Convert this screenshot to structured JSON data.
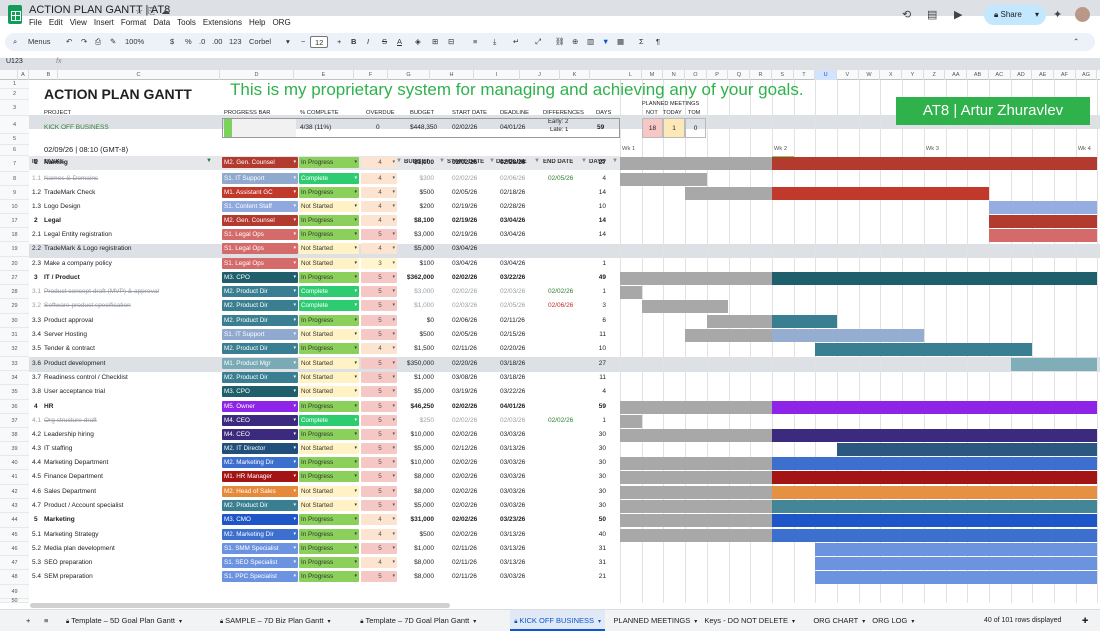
{
  "doc": {
    "title": "ACTION PLAN GANTT | AT8",
    "menus": [
      "File",
      "Edit",
      "View",
      "Insert",
      "Format",
      "Data",
      "Tools",
      "Extensions",
      "Help",
      "ORG"
    ],
    "share": "Share"
  },
  "toolbar": {
    "menus": "Menus",
    "zoom": "100%",
    "currency": "$",
    "percent": "%",
    "dec_less": ".0",
    "dec_more": ".00",
    "num_fmt": "123",
    "font": "Corbel",
    "font_size": "12",
    "bold": "B",
    "italic": "I",
    "strike": "S",
    "text_color": "A",
    "sigma": "Σ"
  },
  "formula": {
    "namebox": "U123",
    "fx": "fx"
  },
  "columns": [
    "A",
    "B",
    "C",
    "D",
    "E",
    "F",
    "G",
    "H",
    "I",
    "J",
    "K",
    "L",
    "M",
    "N",
    "O",
    "P",
    "Q",
    "R",
    "S",
    "T",
    "U",
    "V",
    "W",
    "X",
    "Y",
    "Z",
    "AA",
    "AB",
    "AC",
    "AD",
    "AE",
    "AF",
    "AG"
  ],
  "row_numbers": [
    "1",
    "2",
    "3",
    "4",
    "5",
    "6",
    "7",
    "8",
    "9",
    "10",
    "17",
    "18",
    "19",
    "20",
    "27",
    "28",
    "29",
    "30",
    "31",
    "32",
    "33",
    "34",
    "35",
    "36",
    "37",
    "38",
    "39",
    "40",
    "41",
    "42",
    "43",
    "44",
    "45",
    "46",
    "47",
    "48",
    "49",
    "50",
    "51",
    "52",
    "53"
  ],
  "sheet": {
    "big_title": "ACTION PLAN GANTT",
    "tagline": "This is my proprietary system for managing and achieving any of your goals.",
    "brand": "AT8 | Artur Zhuravlev",
    "summary_headers": {
      "project": "PROJECT",
      "progress": "PROGRESS BAR",
      "complete": "% COMPLETE",
      "overdue": "OVERDUE",
      "budget": "BUDGET",
      "start": "START DATE",
      "deadline": "DEADLINE",
      "diff": "DIFFERENCES",
      "days": "DAYS"
    },
    "summary_values": {
      "project": "KICK OFF BUSINESS",
      "complete": "4/38 (11%)",
      "overdue": "0",
      "budget": "$448,350",
      "start": "02/02/26",
      "deadline": "04/01/26",
      "diff_early": "Early: 2",
      "diff_late": "Late: 1",
      "days": "59"
    },
    "progress_fraction": 0.11,
    "meetings": {
      "title": "PLANNED MEETINGS",
      "not_label": "NOT",
      "today_label": "TODAY",
      "tom_label": "TOM",
      "not": "18",
      "today": "1",
      "tom": "0"
    },
    "timestamp": "02/09/26 | 08:10 (GMT-8)",
    "week_labels": [
      "Wk 1",
      "Wk 2",
      "Wk 3",
      "Wk 4"
    ],
    "dates": [
      "2/2",
      "2/3",
      "2/4",
      "2/5",
      "2/6",
      "2/7",
      "2/8",
      "2/9",
      "2/10",
      "2/11",
      "2/12",
      "2/13",
      "2/14",
      "2/15",
      "2/16",
      "2/17",
      "2/18",
      "2/19",
      "2/20",
      "2/21",
      "2/22",
      "2/23"
    ],
    "table_headers": {
      "id": "ID",
      "tasks": "TASKS",
      "owner": "TASK OWNER",
      "status": "STATUS",
      "priority": "PRIORITY",
      "budget": "BUDGET",
      "start": "START DATE",
      "deadline": "DEADLINE",
      "end": "END DATE",
      "days": "DAYS"
    }
  },
  "tasks": [
    {
      "id": "1",
      "name": "Naming",
      "owner": "M2. Gen. Counsel",
      "status": "In Progress",
      "priority": "4",
      "budget": "$1,000",
      "start": "02/02/26",
      "deadline": "02/28/26",
      "end": "",
      "days": "27",
      "group": true
    },
    {
      "id": "1.1",
      "name": "Names & Domains",
      "owner": "S1. IT Support",
      "status": "Complete",
      "priority": "4",
      "budget": "$300",
      "start": "02/02/26",
      "deadline": "02/06/26",
      "end": "02/05/26",
      "days": "4",
      "done": true
    },
    {
      "id": "1.2",
      "name": "TradeMark Check",
      "owner": "M1. Assistant GC",
      "status": "In Progress",
      "priority": "4",
      "budget": "$500",
      "start": "02/05/26",
      "deadline": "02/18/26",
      "end": "",
      "days": "14"
    },
    {
      "id": "1.3",
      "name": "Logo Design",
      "owner": "S1. Content Staff",
      "status": "Not Started",
      "priority": "4",
      "budget": "$200",
      "start": "02/19/26",
      "deadline": "02/28/26",
      "end": "",
      "days": "10"
    },
    {
      "id": "2",
      "name": "Legal",
      "owner": "M2. Gen. Counsel",
      "status": "In Progress",
      "priority": "4",
      "budget": "$8,100",
      "start": "02/19/26",
      "deadline": "03/04/26",
      "end": "",
      "days": "14",
      "group": true
    },
    {
      "id": "2.1",
      "name": "Legal Entity registration",
      "owner": "S1. Legal Ops",
      "status": "In Progress",
      "priority": "5",
      "budget": "$3,000",
      "start": "02/19/26",
      "deadline": "03/04/26",
      "end": "",
      "days": "14"
    },
    {
      "id": "2.2",
      "name": "TradeMark & Logo registration",
      "owner": "S1. Legal Ops",
      "status": "Not Started",
      "priority": "4",
      "budget": "$5,000",
      "start": "03/04/26",
      "deadline": "",
      "end": "",
      "days": ""
    },
    {
      "id": "2.3",
      "name": "Make a company policy",
      "owner": "S1. Legal Ops",
      "status": "Not Started",
      "priority": "3",
      "budget": "$100",
      "start": "03/04/26",
      "deadline": "03/04/26",
      "end": "",
      "days": "1"
    },
    {
      "id": "3",
      "name": "IT / Product",
      "owner": "M3. CPO",
      "status": "In Progress",
      "priority": "5",
      "budget": "$362,000",
      "start": "02/02/26",
      "deadline": "03/22/26",
      "end": "",
      "days": "49",
      "group": true
    },
    {
      "id": "3.1",
      "name": "Product concept draft (MVP) & approval",
      "owner": "M2. Product Dir",
      "status": "Complete",
      "priority": "5",
      "budget": "$3,000",
      "start": "02/02/26",
      "deadline": "02/03/26",
      "end": "02/02/26",
      "days": "1",
      "done": true
    },
    {
      "id": "3.2",
      "name": "Software product specification",
      "owner": "M2. Product Dir",
      "status": "Complete",
      "priority": "5",
      "budget": "$1,000",
      "start": "02/03/26",
      "deadline": "02/05/26",
      "end": "02/06/26",
      "days": "3",
      "done": true,
      "late": true
    },
    {
      "id": "3.3",
      "name": "Product approval",
      "owner": "M2. Product Dir",
      "status": "In Progress",
      "priority": "5",
      "budget": "$0",
      "start": "02/06/26",
      "deadline": "02/11/26",
      "end": "",
      "days": "6"
    },
    {
      "id": "3.4",
      "name": "Server Hosting",
      "owner": "S1. IT Support",
      "status": "Not Started",
      "priority": "5",
      "budget": "$500",
      "start": "02/05/26",
      "deadline": "02/15/26",
      "end": "",
      "days": "11"
    },
    {
      "id": "3.5",
      "name": "Tender & contract",
      "owner": "M2. Product Dir",
      "status": "In Progress",
      "priority": "4",
      "budget": "$1,500",
      "start": "02/11/26",
      "deadline": "02/20/26",
      "end": "",
      "days": "10"
    },
    {
      "id": "3.6",
      "name": "Product development",
      "owner": "M1. Product Mgr",
      "status": "Not Started",
      "priority": "5",
      "budget": "$350,000",
      "start": "02/20/26",
      "deadline": "03/18/26",
      "end": "",
      "days": "27"
    },
    {
      "id": "3.7",
      "name": "Readiness control / Checklist",
      "owner": "M2. Product Dir",
      "status": "Not Started",
      "priority": "5",
      "budget": "$1,000",
      "start": "03/08/26",
      "deadline": "03/18/26",
      "end": "",
      "days": "11"
    },
    {
      "id": "3.8",
      "name": "User acceptance trial",
      "owner": "M3. CPO",
      "status": "Not Started",
      "priority": "5",
      "budget": "$5,000",
      "start": "03/19/26",
      "deadline": "03/22/26",
      "end": "",
      "days": "4"
    },
    {
      "id": "4",
      "name": "HR",
      "owner": "M5. Owner",
      "status": "In Progress",
      "priority": "5",
      "budget": "$46,250",
      "start": "02/02/26",
      "deadline": "04/01/26",
      "end": "",
      "days": "59",
      "group": true
    },
    {
      "id": "4.1",
      "name": "Org structure draft",
      "owner": "M4. CEO",
      "status": "Complete",
      "priority": "5",
      "budget": "$250",
      "start": "02/02/26",
      "deadline": "02/03/26",
      "end": "02/02/26",
      "days": "1",
      "done": true
    },
    {
      "id": "4.2",
      "name": "Leadership hiring",
      "owner": "M4. CEO",
      "status": "In Progress",
      "priority": "5",
      "budget": "$10,000",
      "start": "02/02/26",
      "deadline": "03/03/26",
      "end": "",
      "days": "30"
    },
    {
      "id": "4.3",
      "name": "IT staffing",
      "owner": "M2. IT Director",
      "status": "Not Started",
      "priority": "5",
      "budget": "$5,000",
      "start": "02/12/26",
      "deadline": "03/13/26",
      "end": "",
      "days": "30"
    },
    {
      "id": "4.4",
      "name": "Marketing Department",
      "owner": "M2. Marketing Dir",
      "status": "In Progress",
      "priority": "5",
      "budget": "$10,000",
      "start": "02/02/26",
      "deadline": "03/03/26",
      "end": "",
      "days": "30"
    },
    {
      "id": "4.5",
      "name": "Finance Department",
      "owner": "M1. HR Manager",
      "status": "In Progress",
      "priority": "5",
      "budget": "$8,000",
      "start": "02/02/26",
      "deadline": "03/03/26",
      "end": "",
      "days": "30"
    },
    {
      "id": "4.6",
      "name": "Sales Department",
      "owner": "M2. Head of Sales",
      "status": "Not Started",
      "priority": "5",
      "budget": "$8,000",
      "start": "02/02/26",
      "deadline": "03/03/26",
      "end": "",
      "days": "30"
    },
    {
      "id": "4.7",
      "name": "Product / Account specialist",
      "owner": "M2. Product Dir",
      "status": "Not Started",
      "priority": "5",
      "budget": "$5,000",
      "start": "02/02/26",
      "deadline": "03/03/26",
      "end": "",
      "days": "30"
    },
    {
      "id": "5",
      "name": "Marketing",
      "owner": "M3. CMO",
      "status": "In Progress",
      "priority": "4",
      "budget": "$31,000",
      "start": "02/02/26",
      "deadline": "03/23/26",
      "end": "",
      "days": "50",
      "group": true
    },
    {
      "id": "5.1",
      "name": "Marketing Strategy",
      "owner": "M2. Marketing Dir",
      "status": "In Progress",
      "priority": "4",
      "budget": "$500",
      "start": "02/02/26",
      "deadline": "03/13/26",
      "end": "",
      "days": "40"
    },
    {
      "id": "5.2",
      "name": "Media plan development",
      "owner": "S1. SMM Specialist",
      "status": "In Progress",
      "priority": "5",
      "budget": "$1,000",
      "start": "02/11/26",
      "deadline": "03/13/26",
      "end": "",
      "days": "31"
    },
    {
      "id": "5.3",
      "name": "SEO preparation",
      "owner": "S1. SEO Specialist",
      "status": "In Progress",
      "priority": "4",
      "budget": "$8,000",
      "start": "02/11/26",
      "deadline": "03/13/26",
      "end": "",
      "days": "31"
    },
    {
      "id": "5.4",
      "name": "SEM preparation",
      "owner": "S1. PPC Specialist",
      "status": "In Progress",
      "priority": "5",
      "budget": "$8,000",
      "start": "02/11/26",
      "deadline": "03/03/26",
      "end": "",
      "days": "21"
    }
  ],
  "owner_colors": {
    "M2. Gen. Counsel": "#b33a2e",
    "S1. IT Support": "#8fa9cf",
    "M1. Assistant GC": "#c0392b",
    "S1. Content Staff": "#8fa9de",
    "S1. Legal Ops": "#d46a6a",
    "M3. CPO": "#1f5e6b",
    "M2. Product Dir": "#3a7f91",
    "M1. Product Mgr": "#79aab5",
    "M5. Owner": "#8e24e8",
    "M4. CEO": "#3b2a7e",
    "M2. IT Director": "#1f4f7a",
    "M2. Marketing Dir": "#3d6fcf",
    "M1. HR Manager": "#a31515",
    "M2. Head of Sales": "#e58a3a",
    "M3. CMO": "#1e55c7",
    "S1. SMM Specialist": "#6c93e0",
    "S1. SEO Specialist": "#6c93e0",
    "S1. PPC Specialist": "#6c93e0"
  },
  "status_colors": {
    "In Progress": "#8ad05a",
    "Complete": "#2ecc71",
    "Not Started": "#fff2c4"
  },
  "priority_colors": {
    "5": "#f6c8c5",
    "4": "#fde4d0",
    "3": "#fff6cf"
  },
  "tabs": [
    "Template – 5D Goal Plan Gantt",
    "SAMPLE – 7D Biz Plan Gantt",
    "Template – 7D Goal Plan Gantt",
    "KICK OFF BUSINESS",
    "PLANNED MEETINGS",
    "Keys - DO NOT DELETE",
    "ORG CHART",
    "ORG LOG"
  ],
  "active_tab": "KICK OFF BUSINESS",
  "rows_displayed": "40 of 101 rows displayed"
}
